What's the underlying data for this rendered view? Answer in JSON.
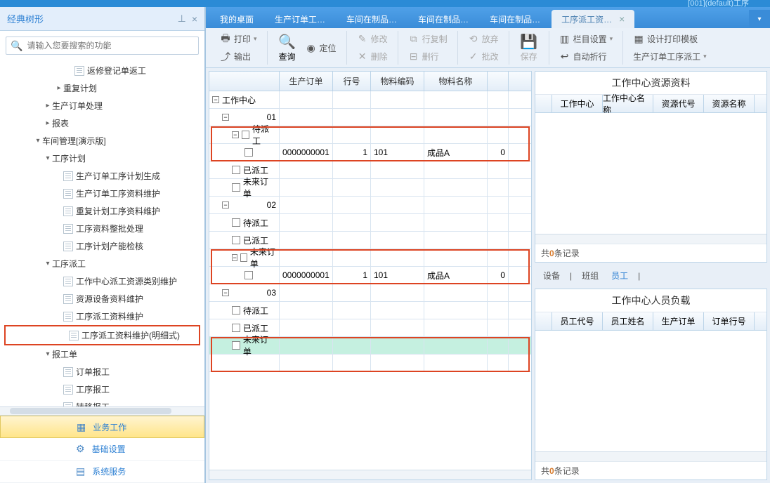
{
  "titleBar": "[001](default)工序",
  "sidebar": {
    "title": "经典树形",
    "searchPlaceholder": "请输入您要搜索的功能",
    "tree": [
      {
        "indent": 4,
        "label": "返修登记单返工",
        "doc": true
      },
      {
        "indent": 3,
        "label": "重复计划",
        "caret": "▸"
      },
      {
        "indent": 2,
        "label": "生产订单处理",
        "caret": "▸"
      },
      {
        "indent": 2,
        "label": "报表",
        "caret": "▸"
      },
      {
        "indent": 1,
        "label": "车间管理[演示版]",
        "caret": "▾"
      },
      {
        "indent": 2,
        "label": "工序计划",
        "caret": "▾"
      },
      {
        "indent": 3,
        "label": "生产订单工序计划生成",
        "doc": true
      },
      {
        "indent": 3,
        "label": "生产订单工序资料维护",
        "doc": true
      },
      {
        "indent": 3,
        "label": "重复计划工序资料维护",
        "doc": true
      },
      {
        "indent": 3,
        "label": "工序资料整批处理",
        "doc": true
      },
      {
        "indent": 3,
        "label": "工序计划产能检核",
        "doc": true
      },
      {
        "indent": 2,
        "label": "工序派工",
        "caret": "▾"
      },
      {
        "indent": 3,
        "label": "工作中心派工资源类别维护",
        "doc": true
      },
      {
        "indent": 3,
        "label": "资源设备资料维护",
        "doc": true
      },
      {
        "indent": 3,
        "label": "工序派工资料维护",
        "doc": true
      },
      {
        "indent": 3,
        "label": "工序派工资料维护(明细式)",
        "doc": true,
        "hl": true
      },
      {
        "indent": 2,
        "label": "报工单",
        "caret": "▾"
      },
      {
        "indent": 3,
        "label": "订单报工",
        "doc": true
      },
      {
        "indent": 3,
        "label": "工序报工",
        "doc": true
      },
      {
        "indent": 3,
        "label": "转移报工",
        "doc": true
      }
    ],
    "bottom": [
      {
        "icon": "▦",
        "label": "业务工作",
        "active": true
      },
      {
        "icon": "⚙",
        "label": "基础设置"
      },
      {
        "icon": "▤",
        "label": "系统服务"
      }
    ]
  },
  "tabs": [
    {
      "label": "我的桌面"
    },
    {
      "label": "生产订单工…"
    },
    {
      "label": "车间在制品…"
    },
    {
      "label": "车间在制品…"
    },
    {
      "label": "车间在制品…"
    },
    {
      "label": "工序派工资…",
      "active": true
    }
  ],
  "toolbar": {
    "print": "打印",
    "output": "输出",
    "query": "查询",
    "locate": "定位",
    "modify": "修改",
    "delete": "删除",
    "copyrow": "行复制",
    "delrow": "删行",
    "abandon": "放弃",
    "approve": "批改",
    "save": "保存",
    "colset": "栏目设置",
    "autowrap": "自动折行",
    "designtpl": "设计打印模板",
    "prodorder": "生产订单工序派工"
  },
  "grid": {
    "headers": [
      "",
      "生产订单",
      "行号",
      "物料编码",
      "物料名称",
      ""
    ],
    "root": "工作中心",
    "groups": [
      {
        "code": "01",
        "children": [
          {
            "label": "待派工",
            "hl": true,
            "rows": [
              {
                "order": "0000000001",
                "line": "1",
                "mat": "101",
                "name": "成品A",
                "v": "0"
              }
            ]
          },
          {
            "label": "已派工"
          },
          {
            "label": "未来订单"
          }
        ]
      },
      {
        "code": "02",
        "children": [
          {
            "label": "待派工"
          },
          {
            "label": "已派工"
          },
          {
            "label": "未来订单",
            "hl": true,
            "rows": [
              {
                "order": "0000000001",
                "line": "1",
                "mat": "101",
                "name": "成品A",
                "v": "0"
              }
            ]
          }
        ]
      },
      {
        "code": "03",
        "children": [
          {
            "label": "待派工"
          },
          {
            "label": "已派工"
          },
          {
            "label": "未来订单",
            "selected": true,
            "hlEmpty": true
          }
        ]
      }
    ]
  },
  "right": {
    "panel1": {
      "title": "工作中心资源资料",
      "headers": [
        "",
        "工作中心",
        "工作中心名称",
        "资源代号",
        "资源名称"
      ],
      "footer_prefix": "共",
      "footer_count": "0",
      "footer_suffix": "条记录"
    },
    "subtabs": [
      "设备",
      "班组",
      "员工"
    ],
    "panel2": {
      "title": "工作中心人员负载",
      "headers": [
        "",
        "员工代号",
        "员工姓名",
        "生产订单",
        "订单行号"
      ],
      "footer_prefix": "共",
      "footer_count": "0",
      "footer_suffix": "条记录"
    }
  }
}
